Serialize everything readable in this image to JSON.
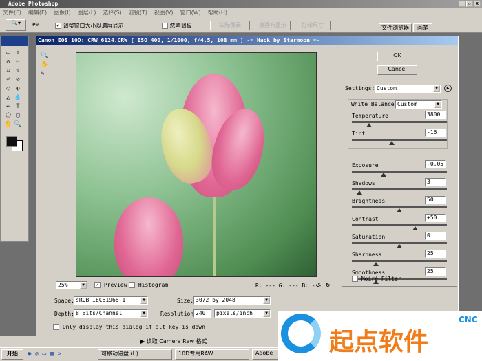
{
  "app": {
    "title": "Adobe Photoshop"
  },
  "menu": [
    "文件(F)",
    "编辑(E)",
    "图像(I)",
    "图层(L)",
    "选择(S)",
    "滤镜(T)",
    "视图(V)",
    "窗口(W)",
    "帮助(H)"
  ],
  "options": {
    "resize_checkbox": "调整窗口大小以满屏显示",
    "ignore_palettes": "忽略调板",
    "actual_pixels": "实际像素",
    "fit_screen": "满画布显示",
    "print_size": "打印尺寸"
  },
  "palette_tabs": [
    "文件浏览器",
    "画笔"
  ],
  "dialog": {
    "title": "Canon EOS 10D:  CRW_6124.CRW [ ISO 400, 1/1000, f/4.5, 108 mm ] -= Hack by Starmoon =-",
    "ok": "OK",
    "cancel": "Cancel",
    "settings_label": "Settings:",
    "settings_value": "Custom",
    "wb_label": "White Balance:",
    "wb_value": "Custom",
    "sliders": [
      {
        "label": "Temperature",
        "value": "3800",
        "pos": 0.18
      },
      {
        "label": "Tint",
        "value": "-16",
        "pos": 0.42
      },
      {
        "label": "Exposure",
        "value": "-0.05",
        "pos": 0.33
      },
      {
        "label": "Shadows",
        "value": "3",
        "pos": 0.08
      },
      {
        "label": "Brightness",
        "value": "50",
        "pos": 0.5
      },
      {
        "label": "Contrast",
        "value": "+50",
        "pos": 0.67
      },
      {
        "label": "Saturation",
        "value": "0",
        "pos": 0.5
      },
      {
        "label": "Sharpness",
        "value": "25",
        "pos": 0.25
      },
      {
        "label": "Smoothness",
        "value": "25",
        "pos": 0.25
      }
    ],
    "moire": "Moiré Filter",
    "zoom": "25%",
    "preview": "Preview",
    "histogram": "Histogram",
    "rgb": "R: --- G: --- B: ---",
    "space_label": "Space:",
    "space_value": "sRGB IEC61966-1",
    "size_label": "Size:",
    "size_value": "3072 by 2048",
    "depth_label": "Depth:",
    "depth_value": "8 Bits/Channel",
    "res_label": "Resolution:",
    "res_value": "240",
    "res_unit": "pixels/inch",
    "alt_only": "Only display this dialog if alt key is down"
  },
  "status": "读取 Camera Raw 格式",
  "taskbar": {
    "start": "开始",
    "items": [
      "可移动磁盘 (I:)",
      "10D专用RAW",
      "Adobe"
    ]
  },
  "watermark": {
    "text": "起点软件",
    "sub": "CNC"
  }
}
